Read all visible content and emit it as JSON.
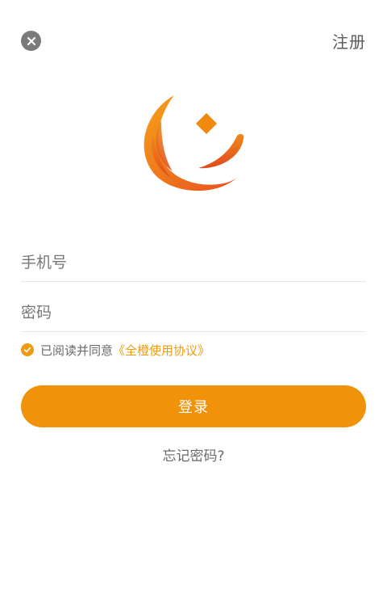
{
  "header": {
    "close_icon": "close-icon",
    "register_label": "注册"
  },
  "logo": {
    "icon": "hand-coin-logo",
    "colors": [
      "#f5a21a",
      "#e8501e"
    ]
  },
  "form": {
    "phone_placeholder": "手机号",
    "phone_value": "",
    "password_placeholder": "密码",
    "password_value": ""
  },
  "agreement": {
    "checked": true,
    "text": "已阅读并同意",
    "link_text": "《全橙使用协议》"
  },
  "actions": {
    "login_label": "登录",
    "forgot_label": "忘记密码?"
  },
  "colors": {
    "accent": "#f0920a",
    "link": "#ef9b12"
  }
}
